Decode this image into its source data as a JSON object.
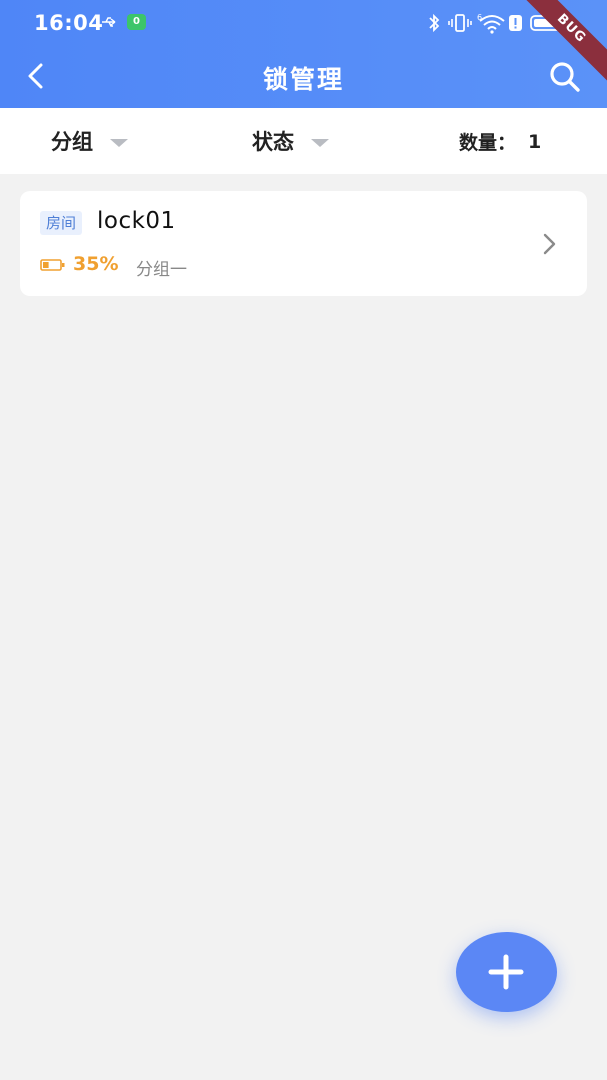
{
  "status_bar": {
    "time": "16:04",
    "app_badge": "0",
    "icons": [
      "usb-icon",
      "bluetooth-icon",
      "vibrate-icon",
      "wifi-icon",
      "alert-icon",
      "battery-icon"
    ],
    "wifi_label": "6"
  },
  "debug_banner": "BUG",
  "nav": {
    "title": "锁管理",
    "back_icon": "chevron-left-icon",
    "search_icon": "search-icon"
  },
  "filters": {
    "group_label": "分组",
    "status_label": "状态",
    "count_label": "数量：",
    "count_value": "1"
  },
  "locks": [
    {
      "tag": "房间",
      "name": "lock01",
      "battery_percent": "35%",
      "battery_level": 0.35,
      "group": "分组一"
    }
  ],
  "fab": {
    "icon": "plus-icon"
  },
  "colors": {
    "header": "#4f86f7",
    "accent": "#5b87f5",
    "battery": "#f0a030",
    "tag_bg": "#e9f0fd",
    "tag_text": "#4f7fd6",
    "debug": "#8b2f3d"
  }
}
